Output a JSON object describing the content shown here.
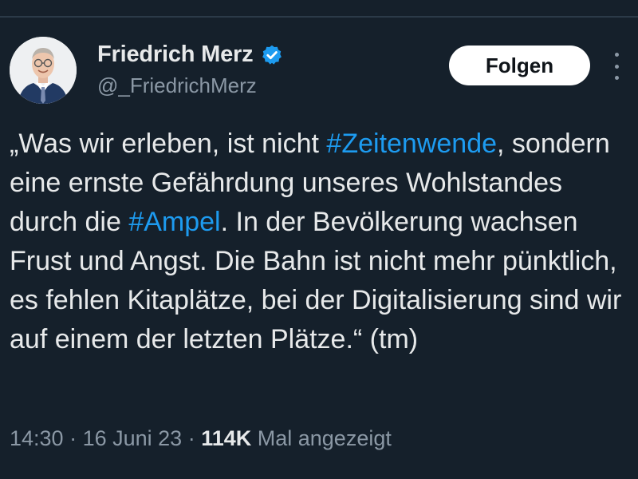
{
  "author": {
    "name": "Friedrich Merz",
    "handle": "@_FriedrichMerz",
    "verified_icon": "verified-badge-icon"
  },
  "follow_button": {
    "label": "Folgen"
  },
  "more_button": {
    "icon": "more-vertical-icon"
  },
  "tweet": {
    "text_parts": [
      {
        "text": "„Was wir erleben, ist nicht ",
        "type": "text"
      },
      {
        "text": "#Zeitenwende",
        "type": "hashtag"
      },
      {
        "text": ", sondern eine ernste Gefährdung unseres Wohlstandes durch die ",
        "type": "text"
      },
      {
        "text": "#Ampel",
        "type": "hashtag"
      },
      {
        "text": ". In der Bevölkerung wachsen Frust und Angst. Die Bahn ist nicht mehr pünktlich, es fehlen Kitaplätze, bei der Digitalisierung sind wir auf einem der letzten Plätze.“ (tm)",
        "type": "text"
      }
    ]
  },
  "meta": {
    "time": "14:30",
    "separator": " · ",
    "date": "16 Juni 23",
    "views_count": "114K",
    "views_label": " Mal angezeigt"
  },
  "colors": {
    "background": "#15202b",
    "text": "#e7e9ea",
    "secondary": "#8b98a5",
    "accent": "#1d9bf0"
  }
}
